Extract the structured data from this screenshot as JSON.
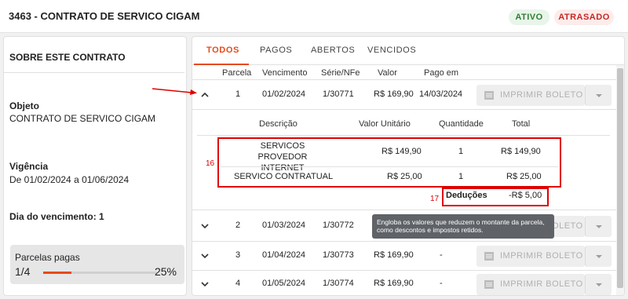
{
  "header": {
    "title": "3463 - CONTRATO DE SERVICO CIGAM",
    "status_active": "ATIVO",
    "status_late": "ATRASADO"
  },
  "colors": {
    "accent": "#e64a19",
    "active_badge": "#2e7d32",
    "late_badge": "#c62828",
    "annotation": "#e00000"
  },
  "sidebar": {
    "title": "SOBRE ESTE CONTRATO",
    "object_label": "Objeto",
    "object_value": "CONTRATO DE SERVICO CIGAM",
    "validity_label": "Vigência",
    "validity_value": "De 01/02/2024 a 01/06/2024",
    "due_day": "Dia do vencimento: 1",
    "paid_label": "Parcelas pagas",
    "paid_value": "1/4",
    "paid_percent": "25%",
    "paid_fraction": 0.25
  },
  "tabs": [
    "TODOS",
    "PAGOS",
    "ABERTOS",
    "VENCIDOS"
  ],
  "table": {
    "headers": [
      "Parcela",
      "Vencimento",
      "Série/NFe",
      "Valor",
      "Pago em"
    ],
    "print_label": "IMPRIMIR BOLETO",
    "rows": [
      {
        "parcela": "1",
        "vencimento": "01/02/2024",
        "serie": "1/30771",
        "valor": "R$ 169,90",
        "pago_em": "14/03/2024"
      },
      {
        "parcela": "2",
        "vencimento": "01/03/2024",
        "serie": "1/30772",
        "valor": "",
        "pago_em": ""
      },
      {
        "parcela": "3",
        "vencimento": "01/04/2024",
        "serie": "1/30773",
        "valor": "R$ 169,90",
        "pago_em": "-"
      },
      {
        "parcela": "4",
        "vencimento": "01/05/2024",
        "serie": "1/30774",
        "valor": "R$ 169,90",
        "pago_em": "-"
      }
    ]
  },
  "detail": {
    "headers": [
      "Descrição",
      "Valor Unitário",
      "Quantidade",
      "Total"
    ],
    "items": [
      {
        "descricao": "SERVICOS PROVEDOR INTERNET",
        "valor_unitario": "R$ 149,90",
        "quantidade": "1",
        "total": "R$ 149,90"
      },
      {
        "descricao": "SERVICO CONTRATUAL",
        "valor_unitario": "R$ 25,00",
        "quantidade": "1",
        "total": "R$ 25,00"
      }
    ],
    "deductions_label": "Deduções",
    "deductions_value": "-R$ 5,00"
  },
  "tooltip": "Engloba os valores que reduzem o montante da parcela, como descontos e impostos retidos.",
  "annotations": {
    "box16": "16",
    "box17": "17"
  }
}
